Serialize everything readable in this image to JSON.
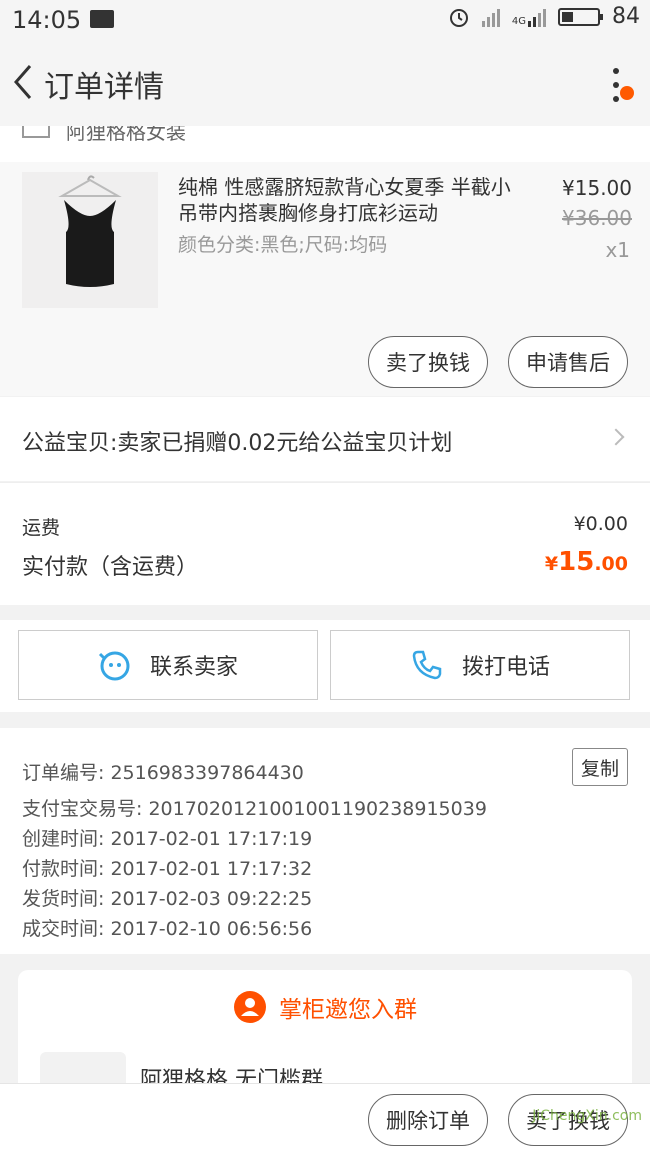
{
  "status_bar": {
    "time": "14:05",
    "network": "4G",
    "battery": "84"
  },
  "nav": {
    "title": "订单详情"
  },
  "shop": {
    "name": "阿狸格格女装"
  },
  "item": {
    "title": "纯棉 性感露脐短款背心女夏季 半截小吊带内搭裹胸修身打底衫运动",
    "sku": "颜色分类:黑色;尺码:均码",
    "price": "¥15.00",
    "original_price": "¥36.00",
    "quantity": "x1",
    "sell_button": "卖了换钱",
    "after_sale_button": "申请售后"
  },
  "charity": {
    "text": "公益宝贝:卖家已捐赠0.02元给公益宝贝计划"
  },
  "fees": {
    "shipping_label": "运费",
    "shipping_value": "¥0.00",
    "paid_label": "实付款（含运费）",
    "paid_currency": "¥",
    "paid_integer": "15",
    "paid_decimal": ".00"
  },
  "contact": {
    "seller_button": "联系卖家",
    "call_button": "拨打电话"
  },
  "order_info": {
    "order_no": "订单编号: 2516983397864430",
    "alipay_no": "支付宝交易号: 2017020121001001190238915039",
    "created": "创建时间: 2017-02-01 17:17:19",
    "paid": "付款时间: 2017-02-01 17:17:32",
    "shipped": "发货时间: 2017-02-03 09:22:25",
    "closed": "成交时间: 2017-02-10 06:56:56",
    "copy_button": "复制"
  },
  "group": {
    "title": "掌柜邀您入群",
    "name": "阿狸格格 无门槛群"
  },
  "bottom": {
    "delete_button": "删除订单",
    "sell_button": "卖了换钱"
  },
  "watermark": "JiChengXin.com",
  "colors": {
    "accent": "#ff5000",
    "contact_icon": "#36a6e4"
  }
}
